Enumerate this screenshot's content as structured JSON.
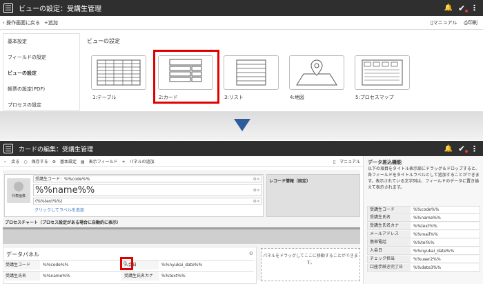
{
  "top": {
    "title": "ビューの設定：受講生管理",
    "toolbar": {
      "back": "操作画面に戻る",
      "add": "+追加",
      "manual": "マニュアル",
      "print": "印刷"
    },
    "nav": [
      "基本設定",
      "フィールドの設定",
      "ビューの設定",
      "帳票の設定(PDF)",
      "プロセスの設定"
    ],
    "panel_heading": "ビューの設定",
    "views": [
      "1:テーブル",
      "2:カード",
      "3:リスト",
      "4:地図",
      "5:プロセスマップ"
    ]
  },
  "bottom": {
    "title": "カードの編集：受講生管理",
    "toolbar": [
      "戻る",
      "保存する",
      "基本設定",
      "表示フィールド",
      "パネルの追加"
    ],
    "manual": "マニュアル",
    "avatar_label": "代表画像",
    "card_fields": [
      "受講生コード：%%code%%",
      "%%name%%",
      "(%%text%%)"
    ],
    "add_label_link": "クリックしてラベルを追加",
    "record_info": "レコード情報（固定）",
    "process_chart": "プロセスチャート（プロセス設定がある場合に自動的に表示）",
    "data_panel": {
      "heading": "データパネル",
      "rows": [
        [
          "受講生コード",
          "%%code%%",
          "入会日",
          "%%nyukai_date%%"
        ],
        [
          "受講生氏名",
          "%%name%%",
          "受講生氏名カナ",
          "%%text%%"
        ]
      ]
    },
    "dropzone": "パネルをドラッグしてここに移動することができます。",
    "side": {
      "heading": "データ差込機能",
      "desc": "以下の項目をタイトル表示部にドラッグ＆ドロップすると、各フィールドをタイトルラベルとして追加することができます。表示されている文字列は、フィールドのデータに置き換えて表示されます。",
      "rows": [
        [
          "受講生コード",
          "%%code%%"
        ],
        [
          "受講生氏名",
          "%%name%%"
        ],
        [
          "受講生氏名カナ",
          "%%text%%"
        ],
        [
          "メールアドレス",
          "%%mail%%"
        ],
        [
          "携帯電話",
          "%%tel%%"
        ],
        [
          "入会日",
          "%%nyukai_date%%"
        ],
        [
          "チェック担当",
          "%%user2%%"
        ],
        [
          "口座手続き完了日",
          "%%date3%%"
        ]
      ]
    }
  }
}
